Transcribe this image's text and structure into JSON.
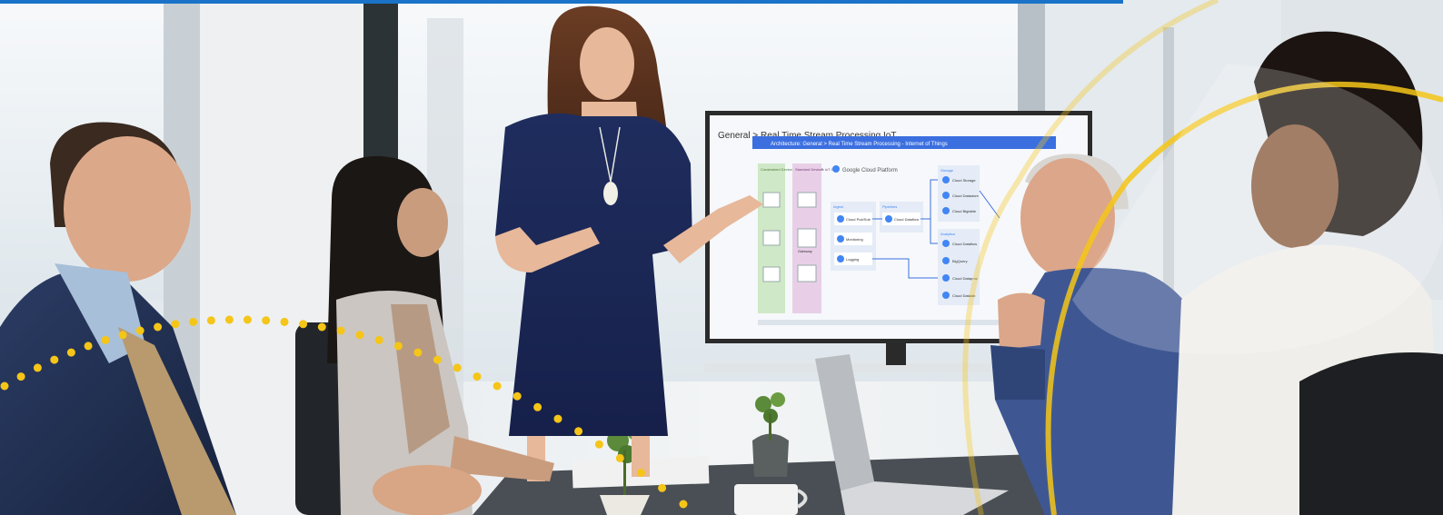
{
  "photo": {
    "description_free": true
  },
  "screen": {
    "breadcrumb": "General > Real Time Stream Processing IoT",
    "banner": "Architecture: General > Real Time Stream Processing - Internet of Things",
    "logo_text": "Google Cloud Platform",
    "col1_label": "Constrained Devices Non-IoT Core IoT",
    "col2_label": "Standard Devices IoT Core",
    "ingest_title": "Ingest",
    "ingest_items": [
      "Cloud Pub/Sub",
      "Monitoring",
      "Logging"
    ],
    "pipelines_title": "Pipelines",
    "pipelines_item": "Cloud Dataflow",
    "storage_title": "Storage",
    "storage_items": [
      "Cloud Storage",
      "Cloud Datastore",
      "Cloud Bigtable"
    ],
    "analytics_title": "Analytics",
    "analytics_items": [
      "Cloud Dataflow",
      "BigQuery",
      "Cloud Dataproc",
      "Cloud Datalab"
    ],
    "gateway_label": "Gateway"
  },
  "colors": {
    "top_bar": "#1a73c8",
    "accent_yellow": "#f5c518",
    "screen_banner": "#3b6fe0",
    "gcp_blue": "#4285f4"
  }
}
